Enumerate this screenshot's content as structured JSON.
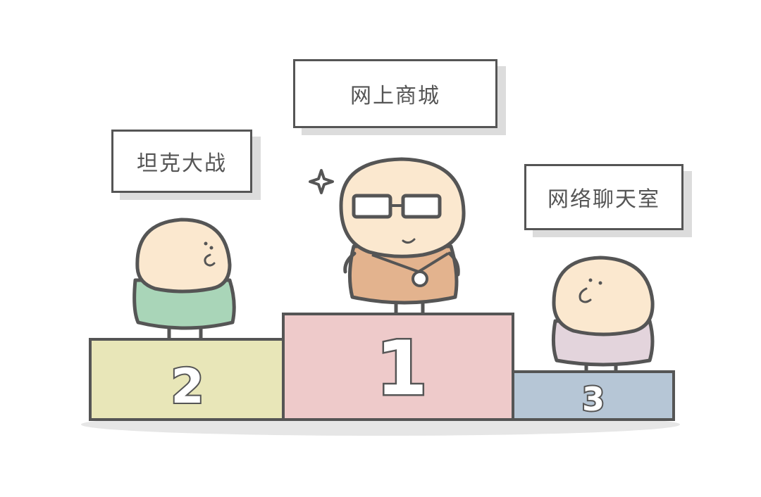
{
  "podium": {
    "first": {
      "rank": "1",
      "label": "网上商城",
      "color": "#eecaca"
    },
    "second": {
      "rank": "2",
      "label": "坦克大战",
      "color": "#e8e6b8"
    },
    "third": {
      "rank": "3",
      "label": "网络聊天室",
      "color": "#b6c6d6"
    }
  },
  "characters": {
    "first_shirt": "#e3b38e",
    "second_shirt": "#a9d5b8",
    "third_shirt": "#e3d4dc",
    "skin": "#fbe8cf",
    "outline": "#555555"
  }
}
